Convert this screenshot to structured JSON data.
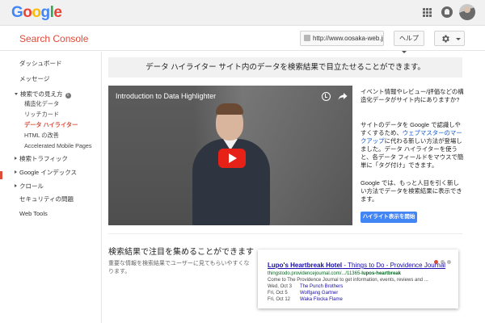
{
  "google_logo": "Google",
  "header": {
    "product_title": "Search Console",
    "site": "http://www.oosaka-web.jp/",
    "help_label": "ヘルプ"
  },
  "sidebar": {
    "items": [
      {
        "label": "ダッシュボード"
      },
      {
        "label": "メッセージ"
      },
      {
        "label": "検索での見え方"
      },
      {
        "label": "構造化データ"
      },
      {
        "label": "リッチカード"
      },
      {
        "label": "データ ハイライター"
      },
      {
        "label": "HTML の改善"
      },
      {
        "label": "Accelerated Mobile Pages"
      },
      {
        "label": "検索トラフィック"
      },
      {
        "label": "Google インデックス"
      },
      {
        "label": "クロール"
      },
      {
        "label": "セキュリティの問題"
      },
      {
        "label": "Web Tools"
      }
    ]
  },
  "main": {
    "banner": "データ ハイライター サイト内のデータを検索結果で目立たせることができます。",
    "video_title": "Introduction to Data Highlighter",
    "para1": "イベント情報やレビュー/評価などの構造化データがサイト内にありますか?",
    "para2_before": "サイトのデータを Google で認識しやすくするため、",
    "para2_link": "ウェブマスターのマークアップ",
    "para2_after": "に代わる新しい方法が登場しました。データ ハイライターを使うと、各データ フィールドをマウスで簡単に「タグ付け」できます。",
    "para3": "Google では、もっと人目を引く新しい方法でデータを検索結果に表示できます。",
    "cta": "ハイライト表示を開始",
    "section_title": "検索結果で注目を集めることができます",
    "section_desc": "重要な情報を検索結果でユーザーに見てもらいやすくなります。"
  },
  "result": {
    "title_main": "Lupo's Heartbreak Hotel",
    "title_rest": " - Things to Do - Providence Journal",
    "url_plain": "thingstodo.providencejournal.com/.../11365-",
    "url_bold": "lupos-heartbreak",
    "snippet": "Come to The Providence Journal to get information, events, reviews and ...",
    "events": [
      {
        "date": "Wed, Oct 3",
        "name": "The Punch Brothers"
      },
      {
        "date": "Fri, Oct 5",
        "name": "Wolfgang Gartner"
      },
      {
        "date": "Fri, Oct 12",
        "name": "Waka Flocka Flame"
      }
    ]
  },
  "colors": {
    "accent": "#dd4b39",
    "link": "#1155cc",
    "button": "#4285f4",
    "play": "#e62117"
  }
}
